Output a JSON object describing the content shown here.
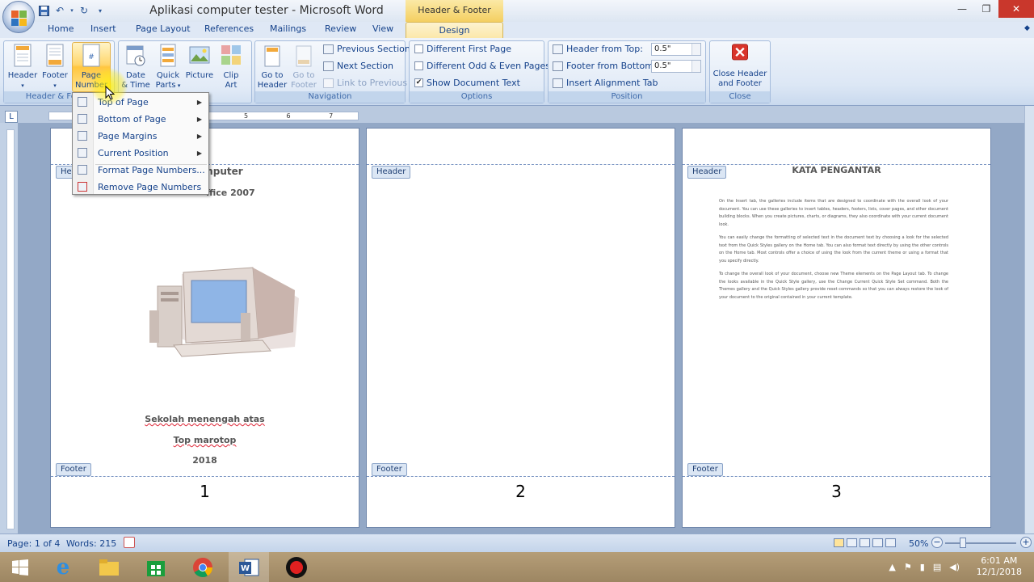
{
  "window": {
    "title": "Aplikasi computer tester - Microsoft Word",
    "contextual_tab_group": "Header & Footer Tools",
    "controls": [
      "minimize-icon",
      "restore-icon",
      "close-icon"
    ]
  },
  "quick_access": [
    "save-icon",
    "undo-icon",
    "redo-icon",
    "customize-icon"
  ],
  "tabs": [
    "Home",
    "Insert",
    "Page Layout",
    "References",
    "Mailings",
    "Review",
    "View",
    "Design"
  ],
  "ribbon": {
    "groups": {
      "header_footer": {
        "label": "Header & Footer",
        "header": "Header",
        "footer": "Footer",
        "page_number_1": "Page",
        "page_number_2": "Number"
      },
      "insert": {
        "date_time_1": "Date",
        "date_time_2": "& Time",
        "quick_parts_1": "Quick",
        "quick_parts_2": "Parts",
        "picture": "Picture",
        "clip_art_1": "Clip",
        "clip_art_2": "Art"
      },
      "navigation": {
        "label": "Navigation",
        "go_to_header_1": "Go to",
        "go_to_header_2": "Header",
        "go_to_footer_1": "Go to",
        "go_to_footer_2": "Footer",
        "previous_section": "Previous Section",
        "next_section": "Next Section",
        "link_to_previous": "Link to Previous"
      },
      "options": {
        "label": "Options",
        "different_first_page": {
          "label": "Different First Page",
          "checked": false
        },
        "different_odd_even": {
          "label": "Different Odd & Even Pages",
          "checked": false
        },
        "show_document_text": {
          "label": "Show Document Text",
          "checked": true
        }
      },
      "position": {
        "label": "Position",
        "header_from_top": {
          "label": "Header from Top:",
          "value": "0.5\""
        },
        "footer_from_bottom": {
          "label": "Footer from Bottom:",
          "value": "0.5\""
        },
        "insert_alignment_tab": "Insert Alignment Tab"
      },
      "close": {
        "label": "Close",
        "close_header_footer_1": "Close Header",
        "close_header_footer_2": "and Footer"
      }
    }
  },
  "page_number_menu": {
    "items": [
      {
        "label": "Top of Page",
        "submenu": true
      },
      {
        "label": "Bottom of Page",
        "submenu": true
      },
      {
        "label": "Page Margins",
        "submenu": true
      },
      {
        "label": "Current Position",
        "submenu": true
      },
      {
        "label": "Format Page Numbers...",
        "submenu": false
      },
      {
        "label": "Remove Page Numbers",
        "submenu": false
      }
    ]
  },
  "ruler_marks": [
    "1",
    "2",
    "3",
    "4",
    "5",
    "6",
    "7"
  ],
  "pages": [
    {
      "header_tag": "Header",
      "footer_tag": "Footer",
      "title_fragment": "omputer",
      "subtitle_fragment": "ffice 2007",
      "school": "Sekolah menengah atas",
      "author": "Top marotop",
      "year": "2018",
      "page_number": "1"
    },
    {
      "header_tag": "Header",
      "footer_tag": "Footer",
      "page_number": "2"
    },
    {
      "header_tag": "Header",
      "footer_tag": "Footer",
      "heading": "KATA PENGANTAR",
      "paragraphs": [
        "On the Insert tab, the galleries include items that are designed to coordinate with the overall look of your document. You can use these galleries to insert tables, headers, footers, lists, cover pages, and other document building blocks. When you create pictures, charts, or diagrams, they also coordinate with your current document look.",
        "You can easily change the formatting of selected text in the document text by choosing a look for the selected text from the Quick Styles gallery on the Home tab. You can also format text directly by using the other controls on the Home tab. Most controls offer a choice of using the look from the current theme or using a format that you specify directly.",
        "To change the overall look of your document, choose new Theme elements on the Page Layout tab. To change the looks available in the Quick Style gallery, use the Change Current Quick Style Set command. Both the Themes gallery and the Quick Styles gallery provide reset commands so that you can always restore the look of your document to the original contained in your current template."
      ],
      "page_number": "3"
    }
  ],
  "status": {
    "page": "Page: 1 of 4",
    "words": "Words: 215",
    "zoom": "50%"
  },
  "taskbar": {
    "apps": [
      "windows-start-icon",
      "internet-explorer-icon",
      "file-explorer-icon",
      "store-icon",
      "chrome-icon",
      "word-icon",
      "recorder-icon"
    ],
    "time": "6:01 AM",
    "date": "12/1/2018"
  },
  "colors": {
    "ribbon_blue": "#15428b",
    "contextual_gold": "#f4cf61",
    "close_red": "#c9372c"
  }
}
